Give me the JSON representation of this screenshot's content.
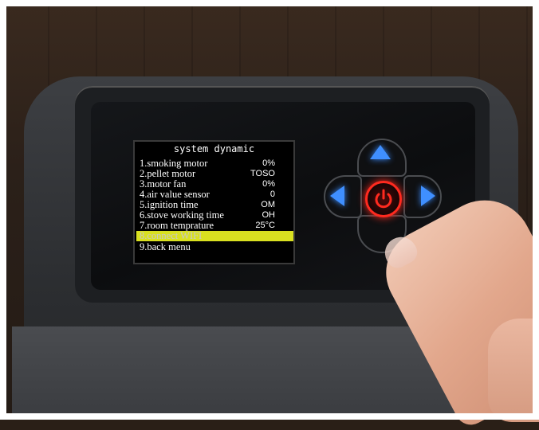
{
  "display": {
    "title": "system dynamic",
    "items": [
      {
        "label": "1.smoking motor",
        "value": "0%"
      },
      {
        "label": "2.pellet motor",
        "value": "TOSO"
      },
      {
        "label": "3.motor fan",
        "value": "0%"
      },
      {
        "label": "4.air value sensor",
        "value": "0"
      },
      {
        "label": "5.ignition time",
        "value": "OM"
      },
      {
        "label": "6.stove working time",
        "value": "OH"
      },
      {
        "label": "7.room temprature",
        "value": "25°C"
      },
      {
        "label": "8.connect WIFI",
        "value": ""
      },
      {
        "label": "9.back menu",
        "value": ""
      }
    ],
    "selected_index": 7,
    "highlight_color": "#d9e020"
  },
  "controls": {
    "up_icon": "chevron-up-icon",
    "down_icon": "chevron-down-icon",
    "left_icon": "chevron-left-icon",
    "right_icon": "chevron-right-icon",
    "power_icon": "power-icon",
    "arrow_color": "#3f8fff",
    "power_color": "#ff2a1f"
  }
}
